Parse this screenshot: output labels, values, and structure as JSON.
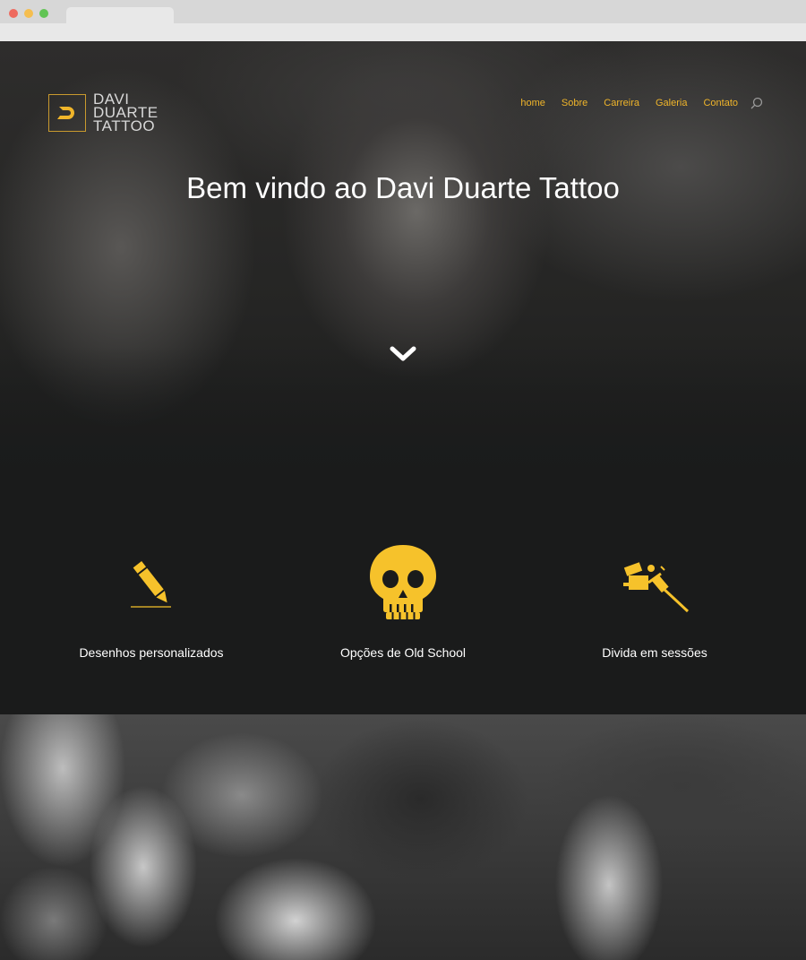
{
  "browser": {
    "tab_title": ""
  },
  "brand": {
    "line1": "DAVI",
    "line2": "DUARTE",
    "line3": "TATTOO"
  },
  "nav": {
    "items": [
      "home",
      "Sobre",
      "Carreira",
      "Galeria",
      "Contato"
    ]
  },
  "hero": {
    "title": "Bem vindo ao Davi Duarte Tattoo"
  },
  "features": [
    {
      "label": "Desenhos personalizados",
      "icon": "pencil-icon"
    },
    {
      "label": "Opções de Old School",
      "icon": "skull-icon"
    },
    {
      "label": "Divida em sessões",
      "icon": "tattoo-machine-icon"
    }
  ],
  "colors": {
    "accent": "#f0b52a",
    "icon_yellow": "#f6c22b",
    "background": "#1a1b1b",
    "text": "#ffffff"
  }
}
